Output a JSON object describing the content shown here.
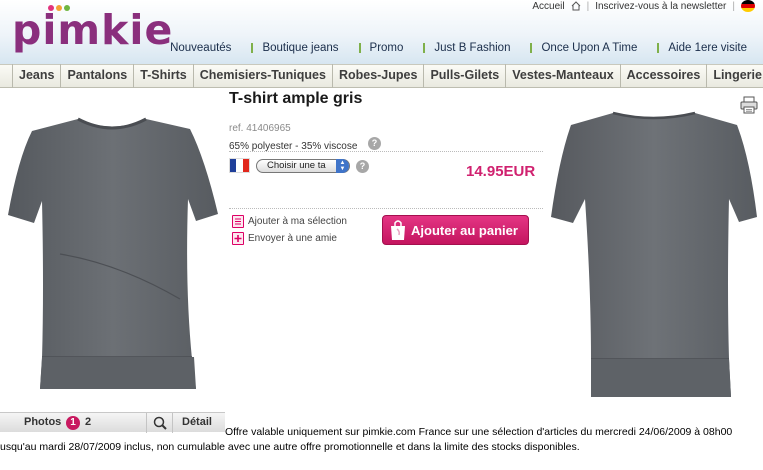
{
  "header": {
    "logo": "pimkie",
    "top_links": {
      "account": "Accueil",
      "newsletter": "Inscrivez-vous à la newsletter"
    },
    "nav": [
      "Nouveautés",
      "Boutique jeans",
      "Promo",
      "Just B Fashion",
      "Once Upon A Time",
      "Aide 1ere visite"
    ]
  },
  "categories": [
    "Jeans",
    "Pantalons",
    "T-Shirts",
    "Chemisiers-Tuniques",
    "Robes-Jupes",
    "Pulls-Gilets",
    "Vestes-Manteaux",
    "Accessoires",
    "Lingerie"
  ],
  "product": {
    "title": "T-shirt ample gris",
    "ref": "ref. 41406965",
    "composition": "65% polyester - 35% viscose",
    "size_select": "Choisir une ta",
    "price": "14.95EUR",
    "actions": {
      "wishlist": "Ajouter à ma sélection",
      "send_friend": "Envoyer à une amie"
    },
    "add_to_cart": "Ajouter au panier",
    "help_icon": "?"
  },
  "photos": {
    "label": "Photos",
    "pages": [
      "1",
      "2"
    ],
    "detail": "Détail"
  },
  "offer": {
    "line1": "Offre valable uniquement sur pimkie.com France sur une sélection d'articles du mercredi 24/06/2009 à 08h00",
    "line2": "usqu'au mardi 28/07/2009 inclus, non cumulable avec une autre offre promotionnelle et dans la limite des stocks disponibles."
  },
  "colors": {
    "brand": "#8a2f7d",
    "price": "#d0216f",
    "cart_button": "#d4246f",
    "nav_separator": "#7fb04a"
  },
  "icons": [
    "home-icon",
    "german-flag-icon",
    "print-icon",
    "help-icon",
    "french-flag-icon",
    "wishlist-icon",
    "email-icon",
    "shopping-bag-icon",
    "zoom-icon"
  ]
}
